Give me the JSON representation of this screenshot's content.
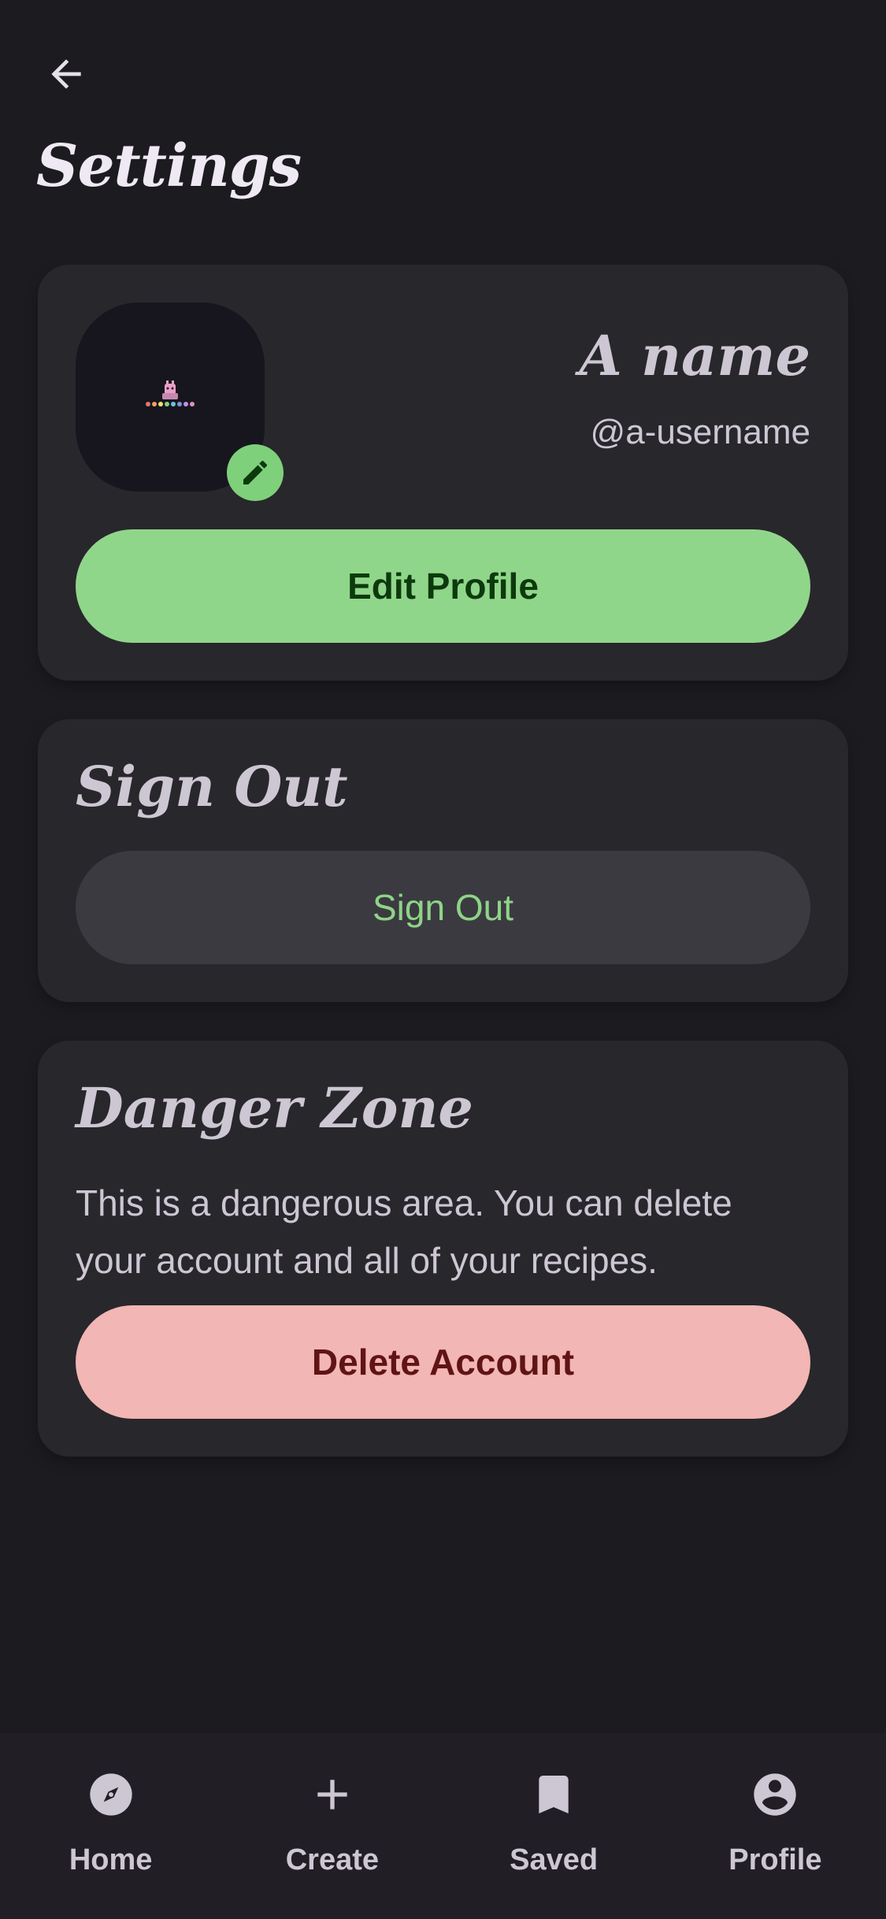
{
  "header": {
    "title": "Settings"
  },
  "profile": {
    "display_name": "A name",
    "username": "@a-username",
    "edit_button": "Edit Profile"
  },
  "sign_out": {
    "title": "Sign Out",
    "button": "Sign Out"
  },
  "danger_zone": {
    "title": "Danger Zone",
    "description": "This is a dangerous area. You can delete your account and all of your recipes.",
    "button": "Delete Account"
  },
  "nav": {
    "items": [
      {
        "label": "Home",
        "icon": "compass-icon"
      },
      {
        "label": "Create",
        "icon": "plus-icon"
      },
      {
        "label": "Saved",
        "icon": "bookmark-icon"
      },
      {
        "label": "Profile",
        "icon": "account-circle-icon"
      }
    ]
  },
  "colors": {
    "background": "#1c1b20",
    "card": "#28272c",
    "primary": "#90d68a",
    "danger": "#f2b6b4"
  }
}
